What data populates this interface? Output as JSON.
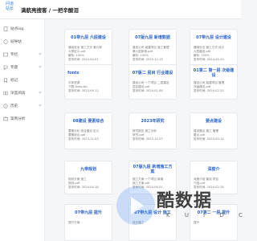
{
  "header": {
    "logo_line1": "问道",
    "logo_line2": "站长",
    "site_title": "满航亮搜客 / 一把辛酸泪"
  },
  "sidebar": {
    "items": [
      {
        "label": "站点log",
        "icon": "doc-icon"
      },
      {
        "label": "站导站",
        "icon": "nav-icon"
      },
      {
        "label": "专栏",
        "icon": "column-icon"
      },
      {
        "label": "专题",
        "icon": "topic-icon"
      },
      {
        "label": "标记",
        "icon": "bookmark-icon"
      },
      {
        "label": "深度阅读",
        "icon": "read-icon"
      },
      {
        "label": "历史",
        "icon": "history-icon"
      },
      {
        "label": "案例分析",
        "icon": "case-icon"
      }
    ]
  },
  "cards": [
    {
      "title": "01带九层 六层建设",
      "lines": [
        "通用安全 施工方式 第九带",
        "九带定义.pdf",
        "解析: 100%",
        "发布时间: 2024-04-01"
      ]
    },
    {
      "title": "07版九层 新增数据",
      "lines": [
        "建设公司 组建项目 施工管理",
        "第九层新增.pdf",
        "解析: 100%",
        "发布时间: 2023-12-15"
      ]
    },
    {
      "title": "07带九层 设计建设",
      "lines": [
        "通用安全 施工方式 设计",
        "九层建设.pdf",
        "解析: 100%",
        "发布时间: 2024-05-10"
      ]
    },
    {
      "title": "fonts",
      "lines": [
        "字体资源",
        "下载 fonts.zip",
        "发布时间: 2023-09-12"
      ]
    },
    {
      "title": "07版二 层目 行业建设",
      "lines": [
        "建设公司 一个项目 二层建设",
        "层目建设.pdf",
        "发布时间: 2024-01-08"
      ]
    },
    {
      "title": "01第二 第一层 次级建设",
      "lines": [
        "建设公司 组建项目 管理",
        "次级建设.pdf",
        "发布时间: 2024-02-20"
      ]
    },
    {
      "title": "08建设 要素综合",
      "lines": [
        "要素分析 综合建设 定义",
        "要素综合.pdf",
        "发布时间: 2023-11-03"
      ]
    },
    {
      "title": "2023年研究",
      "lines": [
        "研究报告 施工分析",
        "研究.pdf",
        "发布时间: 2023-10-25"
      ]
    },
    {
      "title": "要点建设",
      "lines": [
        "建设要点 施工 管理",
        "要点.pdf",
        "发布时间: 2024-03-14"
      ]
    },
    {
      "title": "九带规划",
      "lines": [
        "规划方案 施工",
        "规划.pdf",
        "发布时间: 2024-04-18"
      ]
    },
    {
      "title": "07版九层 新增施工方案",
      "lines": [
        "施工方案 一个项目 新增",
        "施工方案.pdf",
        "发布时间: 2024-06-01"
      ]
    },
    {
      "title": "深度介",
      "lines": [
        "深度介绍 建设 项目",
        "介绍.pdf",
        "发布时间: 2024-02-28"
      ]
    },
    {
      "title": "07带九层 提升",
      "lines": [
        "提升方案"
      ]
    },
    {
      "title": "07带九层 设计 施工",
      "lines": [
        "设计施工"
      ]
    },
    {
      "title": "07第二 一层 提升",
      "lines": [
        "提升"
      ]
    }
  ],
  "watermark": {
    "main": "酷数据",
    "sub": "K U I D C"
  },
  "colors": {
    "accent": "#2f7cf6",
    "link": "#2b63c9"
  }
}
